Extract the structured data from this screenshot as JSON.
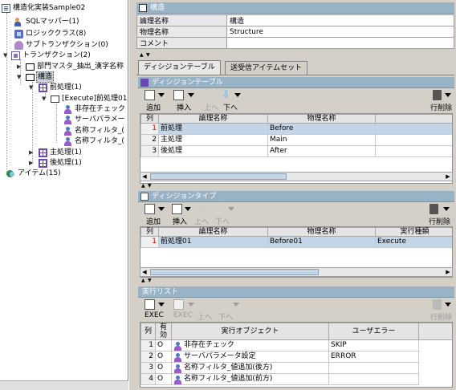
{
  "tree": {
    "root": "構造化実装Sample02",
    "items": [
      {
        "label": "SQLマッパー(1)",
        "icon": "mapper-icon"
      },
      {
        "label": "ロジッククラス(8)",
        "icon": "logic-class-icon"
      },
      {
        "label": "サブトランザクション(0)",
        "icon": "sub-transaction-icon"
      },
      {
        "label": "トランザクション(2)",
        "icon": "transaction-icon"
      },
      {
        "label": "部門マスタ_抽出_漢字名称",
        "icon": "folder-icon"
      },
      {
        "label": "構造",
        "icon": "folder-icon"
      },
      {
        "label": "前処理(1)",
        "icon": "decision-icon"
      },
      {
        "label": "[Execute]前処理01(4",
        "icon": "execute-icon"
      },
      {
        "label": "非存在チェック",
        "icon": "person-icon"
      },
      {
        "label": "サーバパラメー",
        "icon": "person-icon"
      },
      {
        "label": "名称フィルタ_(",
        "icon": "person-icon"
      },
      {
        "label": "名称フィルタ_(",
        "icon": "person-icon"
      },
      {
        "label": "主処理(1)",
        "icon": "decision-icon"
      },
      {
        "label": "後処理(1)",
        "icon": "decision-icon"
      },
      {
        "label": "アイテム(15)",
        "icon": "item-icon"
      }
    ]
  },
  "header": {
    "title": "構造",
    "rows": [
      {
        "label": "論理名称",
        "value": "構造"
      },
      {
        "label": "物理名称",
        "value": "Structure"
      },
      {
        "label": "コメント",
        "value": ""
      }
    ]
  },
  "tabs": [
    {
      "label": "ディシジョンテーブル",
      "active": true
    },
    {
      "label": "送受信アイテムセット",
      "active": false
    }
  ],
  "decision_table": {
    "title": "ディシジョンテーブル",
    "toolbar": {
      "add": "追加",
      "insert": "挿入",
      "up": "上へ",
      "down": "下へ",
      "delete": "行削除"
    },
    "columns": [
      "列",
      "論理名称",
      "物理名称",
      ""
    ],
    "rows": [
      {
        "no": "1",
        "logical": "前処理",
        "physical": "Before",
        "extra": ""
      },
      {
        "no": "2",
        "logical": "主処理",
        "physical": "Main",
        "extra": ""
      },
      {
        "no": "3",
        "logical": "後処理",
        "physical": "After",
        "extra": ""
      }
    ]
  },
  "decision_type": {
    "title": "ディシジョンタイプ",
    "toolbar": {
      "add": "追加",
      "insert": "挿入",
      "up": "上へ",
      "down": "下へ",
      "delete": "行削除"
    },
    "columns": [
      "列",
      "論理名称",
      "物理名称",
      "実行種類"
    ],
    "rows": [
      {
        "no": "1",
        "logical": "前処理01",
        "physical": "Before01",
        "kind": "Execute"
      }
    ]
  },
  "exec_list": {
    "title": "実行リスト",
    "toolbar": {
      "exec1": "EXEC",
      "exec2": "EXEC",
      "up": "上へ",
      "down": "下へ",
      "delete": "行削除"
    },
    "columns": [
      "列",
      "有効",
      "実行オブジェクト",
      "ユーザエラー"
    ],
    "rows": [
      {
        "no": "1",
        "enabled": "O",
        "object": "非存在チェック",
        "error": "SKIP"
      },
      {
        "no": "2",
        "enabled": "O",
        "object": "サーバパラメータ設定",
        "error": "ERROR"
      },
      {
        "no": "3",
        "enabled": "O",
        "object": "名称フィルタ_値追加(後方)",
        "error": ""
      },
      {
        "no": "4",
        "enabled": "O",
        "object": "名称フィルタ_値追加(前方)",
        "error": ""
      }
    ]
  }
}
